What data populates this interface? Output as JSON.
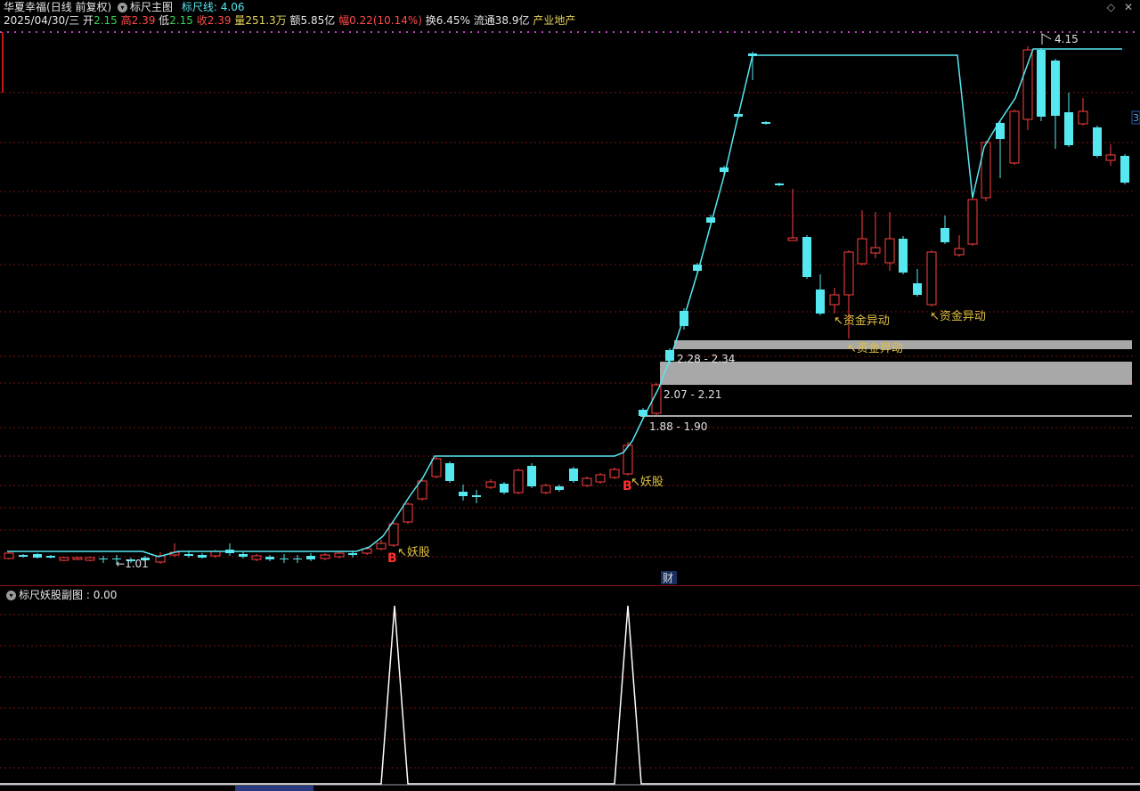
{
  "header": {
    "stock_name": "华夏幸福",
    "period": "(日线 前复权)",
    "main_indicator": "标尺主图",
    "ruler_label": "标尺线:",
    "ruler_value": "4.06",
    "date": "2025/04/30/三",
    "open_label": "开",
    "open": "2.15",
    "high_label": "高",
    "high": "2.39",
    "low_label": "低",
    "low": "2.15",
    "close_label": "收",
    "close": "2.39",
    "volume_label": "量",
    "volume": "251.3万",
    "amount_label": "额",
    "amount": "5.85亿",
    "change_label": "幅",
    "change": "0.22(10.14%)",
    "turnover_label": "换",
    "turnover": "6.45%",
    "float_label": "流通",
    "float_cap": "38.9亿",
    "sector": "产业地产"
  },
  "main_chart": {
    "zones": [
      {
        "label": "2.28 - 2.34"
      },
      {
        "label": "2.07 - 2.21"
      },
      {
        "label": "1.88 - 1.90"
      }
    ],
    "annotations": {
      "monster_1": "妖股",
      "monster_2": "妖股",
      "fund_1": "资金异动",
      "fund_2": "资金异动",
      "fund_3": "资金异动",
      "buy_1": "B",
      "buy_2": "B",
      "low_mark": "1.01",
      "high_mark": "4.15",
      "right_edge": "3",
      "finance_badge": "财"
    }
  },
  "sub_chart": {
    "title": "标尺妖股副图",
    "value": "0.00"
  },
  "colors": {
    "up": "#ff4040",
    "down": "#56e8f0",
    "ruler": "#56e8f0",
    "zone": "#a8a8a8",
    "grid": "#7a1010"
  },
  "icons": [
    "dropdown-icon",
    "diamond-icon",
    "close-icon"
  ]
}
